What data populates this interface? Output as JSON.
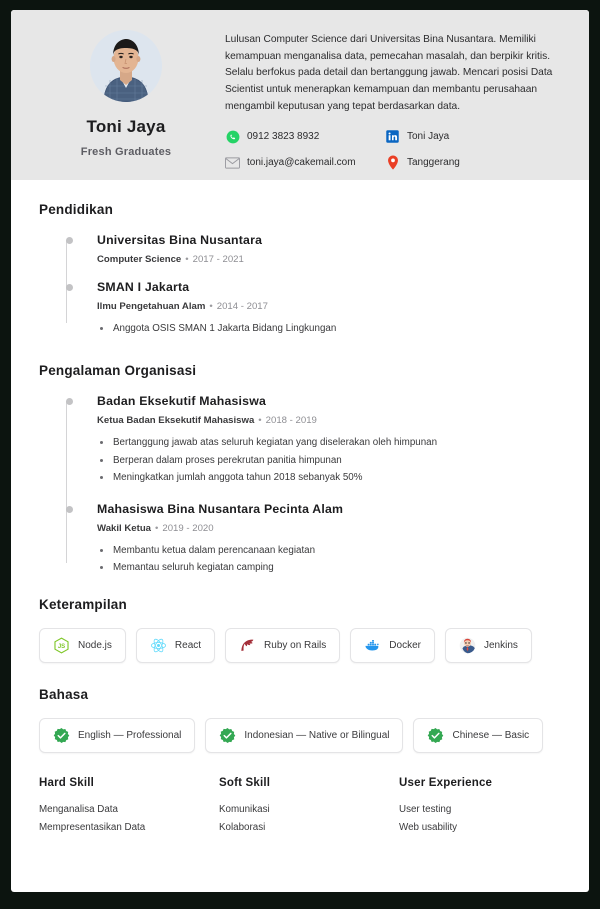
{
  "header": {
    "name": "Toni Jaya",
    "job_title": "Fresh Graduates",
    "avatar_alt": "profile-photo",
    "summary": "Lulusan Computer Science dari Universitas Bina Nusantara. Memiliki kemampuan menganalisa data, pemecahan masalah, dan berpikir kritis. Selalu berfokus pada detail dan bertanggung jawab. Mencari posisi Data Scientist untuk menerapkan kemampuan dan membantu perusahaan mengambil keputusan yang tepat berdasarkan data.",
    "contacts": [
      {
        "icon": "whatsapp-icon",
        "value": "0912 3823 8932"
      },
      {
        "icon": "linkedin-icon",
        "value": "Toni Jaya"
      },
      {
        "icon": "email-icon",
        "value": "toni.jaya@cakemail.com"
      },
      {
        "icon": "location-pin-icon",
        "value": "Tanggerang"
      }
    ]
  },
  "education": {
    "title": "Pendidikan",
    "entries": [
      {
        "organization": "Universitas Bina Nusantara",
        "role": "Computer Science",
        "separator": "•",
        "years": "2017 - 2021",
        "bullets": []
      },
      {
        "organization": "SMAN I Jakarta",
        "role": "Ilmu Pengetahuan Alam",
        "separator": "•",
        "years": "2014 - 2017",
        "bullets": [
          "Anggota OSIS SMAN 1 Jakarta Bidang Lingkungan"
        ]
      }
    ]
  },
  "organization_experience": {
    "title": "Pengalaman Organisasi",
    "entries": [
      {
        "organization": "Badan Eksekutif Mahasiswa",
        "role": "Ketua Badan Eksekutif Mahasiswa",
        "separator": "•",
        "years": "2018 - 2019",
        "bullets": [
          "Bertanggung jawab atas seluruh kegiatan yang diselerakan oleh himpunan",
          "Berperan dalam proses perekrutan panitia himpunan",
          "Meningkatkan jumlah anggota tahun 2018 sebanyak 50%"
        ]
      },
      {
        "organization": "Mahasiswa Bina Nusantara Pecinta Alam",
        "role": "Wakil Ketua",
        "separator": "•",
        "years": "2019 - 2020",
        "bullets": [
          "Membantu ketua dalam perencanaan kegiatan",
          "Memantau seluruh kegiatan camping"
        ]
      }
    ]
  },
  "skills": {
    "title": "Keterampilan",
    "items": [
      {
        "label": "Node.js",
        "icon": "nodejs-icon"
      },
      {
        "label": "React",
        "icon": "react-icon"
      },
      {
        "label": "Ruby on Rails",
        "icon": "rails-icon"
      },
      {
        "label": "Docker",
        "icon": "docker-icon"
      },
      {
        "label": "Jenkins",
        "icon": "jenkins-icon"
      }
    ]
  },
  "languages": {
    "title": "Bahasa",
    "items": [
      {
        "label": "English — Professional",
        "icon": "verified-check-icon"
      },
      {
        "label": "Indonesian — Native or Bilingual",
        "icon": "verified-check-icon"
      },
      {
        "label": "Chinese — Basic",
        "icon": "verified-check-icon"
      }
    ]
  },
  "footer_columns": [
    {
      "title": "Hard Skill",
      "items": [
        "Menganalisa Data",
        "Mempresentasikan Data"
      ]
    },
    {
      "title": "Soft Skill",
      "items": [
        "Komunikasi",
        "Kolaborasi"
      ]
    },
    {
      "title": "User Experience",
      "items": [
        "User testing",
        "Web usability"
      ]
    }
  ],
  "colors": {
    "page_background": "#0c140f",
    "paper": "#ffffff",
    "header_band": "#e7e7e7",
    "heading_text": "#1d1d1f",
    "body_text": "#3a3a3c",
    "muted_text": "#8e8e93",
    "timeline": "#c3c3c5",
    "whatsapp_green": "#25d366",
    "linkedin_blue": "#0a66c2",
    "pin_red": "#ea3f25",
    "verified_green": "#34a853",
    "nodejs_green": "#7fc728",
    "react_cyan": "#61dafb",
    "rails_red": "#a4303a",
    "docker_blue": "#2496ed"
  }
}
